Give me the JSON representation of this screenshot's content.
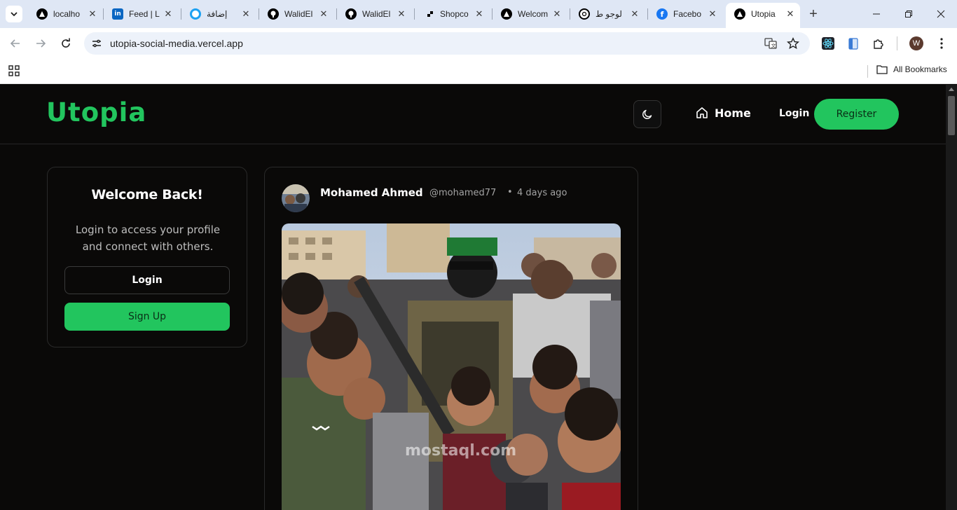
{
  "browser": {
    "tabs": [
      {
        "title": "localho",
        "favicon": "triangle-icon",
        "color": "#000000"
      },
      {
        "title": "Feed | L",
        "favicon": "linkedin-icon",
        "color": "#0a66c2"
      },
      {
        "title": "إضافة",
        "favicon": "circle-icon",
        "color": "#1da1f2"
      },
      {
        "title": "WalidEl",
        "favicon": "github-icon",
        "color": "#000000"
      },
      {
        "title": "WalidEl",
        "favicon": "github-icon",
        "color": "#000000"
      },
      {
        "title": "Shopco",
        "favicon": "shopco-icon",
        "color": "#000000"
      },
      {
        "title": "Welcom",
        "favicon": "triangle-icon",
        "color": "#000000"
      },
      {
        "title": "لوجو ط",
        "favicon": "chatgpt-icon",
        "color": "#000000"
      },
      {
        "title": "Facebo",
        "favicon": "facebook-icon",
        "color": "#1877f2"
      },
      {
        "title": "Utopia",
        "favicon": "triangle-icon",
        "color": "#000000",
        "active": true
      }
    ],
    "url": "utopia-social-media.vercel.app",
    "profile_initial": "W",
    "bookmarks_label": "All Bookmarks"
  },
  "site": {
    "logo": "Utopia",
    "nav": {
      "home": "Home",
      "login": "Login",
      "register": "Register"
    },
    "accent_color": "#22c55e"
  },
  "welcome": {
    "title": "Welcome Back!",
    "text": "Login to access your profile and connect with others.",
    "login_button": "Login",
    "signup_button": "Sign Up"
  },
  "post": {
    "author_name": "Mohamed Ahmed",
    "author_handle": "@mohamed77",
    "separator": "•",
    "time": "4 days ago",
    "watermark": "mostaql.com"
  }
}
